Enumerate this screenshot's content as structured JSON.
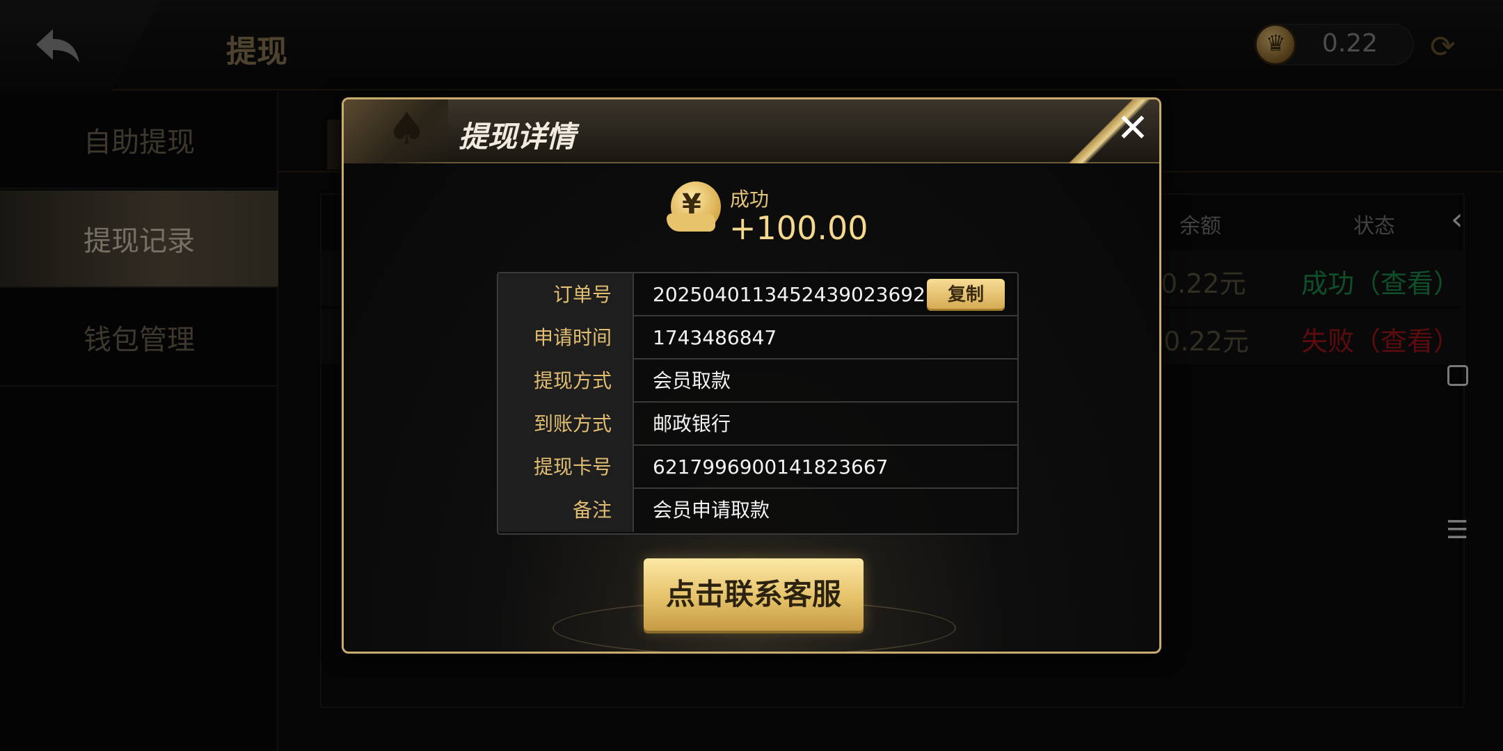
{
  "header": {
    "title": "提现",
    "balance": "0.22"
  },
  "sidebar": {
    "items": [
      {
        "label": "自助提现"
      },
      {
        "label": "提现记录"
      },
      {
        "label": "钱包管理"
      }
    ]
  },
  "records": {
    "columns": [
      "余额",
      "状态"
    ],
    "rows": [
      {
        "balance": "0.22元",
        "status": "成功（查看）"
      },
      {
        "balance": "00.22元",
        "status": "失败（查看）"
      }
    ]
  },
  "modal": {
    "title": "提现详情",
    "status": "成功",
    "amount": "+100.00",
    "details": [
      {
        "label": "订单号",
        "value": "2025040113452439023692..."
      },
      {
        "label": "申请时间",
        "value": "1743486847"
      },
      {
        "label": "提现方式",
        "value": "会员取款"
      },
      {
        "label": "到账方式",
        "value": "邮政银行"
      },
      {
        "label": "提现卡号",
        "value": "6217996900141823667"
      },
      {
        "label": "备注",
        "value": "会员申请取款"
      }
    ],
    "copy_label": "复制",
    "contact_label": "点击联系客服",
    "close_glyph": "✕"
  }
}
